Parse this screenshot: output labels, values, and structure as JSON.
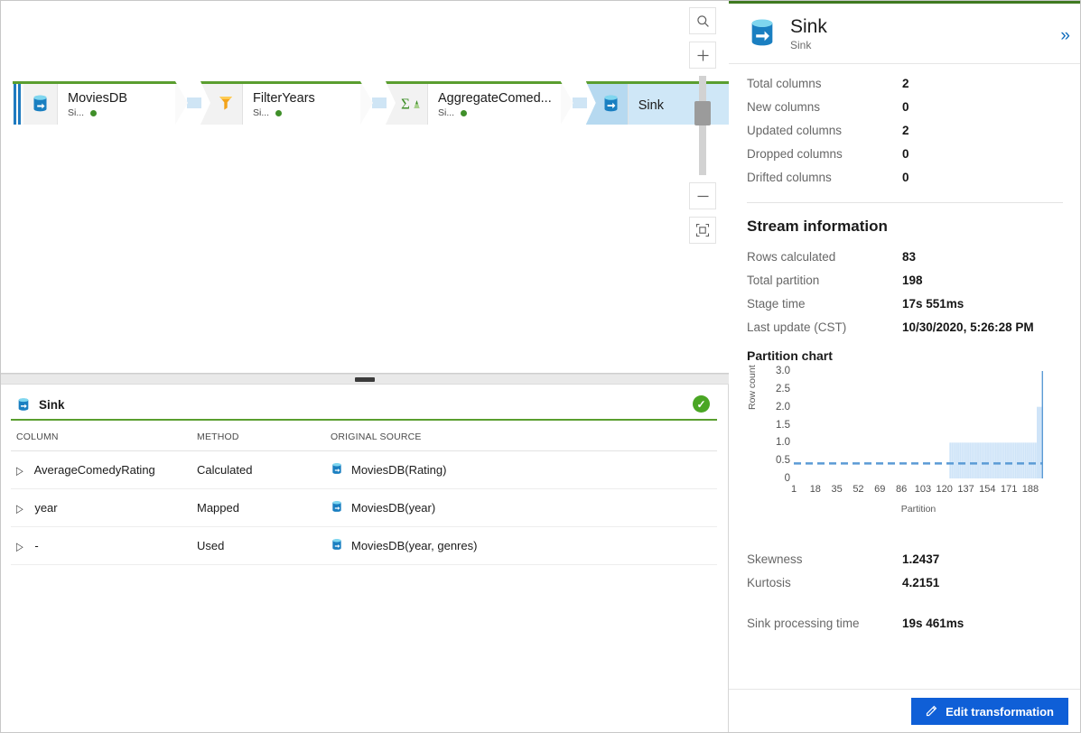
{
  "graph": {
    "nodes": [
      {
        "title": "MoviesDB",
        "subtitle": "Si...",
        "icon": "source-db-icon",
        "status": "ok",
        "selected": false
      },
      {
        "title": "FilterYears",
        "subtitle": "Si...",
        "icon": "filter-icon",
        "status": "ok",
        "selected": false
      },
      {
        "title": "AggregateComed...",
        "subtitle": "Si...",
        "icon": "aggregate-sigma-icon",
        "status": "ok",
        "selected": false
      },
      {
        "title": "Sink",
        "subtitle": "",
        "icon": "sink-db-icon",
        "status": "ok",
        "selected": true
      }
    ]
  },
  "zoom_toolbar": {
    "search_icon": "search-icon",
    "zoom_in_label": "+",
    "zoom_out_label": "–",
    "fit_icon": "fit-to-screen-icon"
  },
  "inspect_table": {
    "title": "Sink",
    "status_icon": "success-check-icon",
    "headers": [
      "COLUMN",
      "METHOD",
      "ORIGINAL SOURCE"
    ],
    "rows": [
      {
        "column": "AverageComedyRating",
        "method": "Calculated",
        "source": "MoviesDB(Rating)"
      },
      {
        "column": "year",
        "method": "Mapped",
        "source": "MoviesDB(year)"
      },
      {
        "column": "-",
        "method": "Used",
        "source": "MoviesDB(year, genres)"
      }
    ]
  },
  "panel": {
    "title": "Sink",
    "subtitle": "Sink",
    "collapse_icon": "double-chevron-right-icon",
    "column_stats": [
      {
        "label": "Total columns",
        "value": "2"
      },
      {
        "label": "New columns",
        "value": "0"
      },
      {
        "label": "Updated columns",
        "value": "2"
      },
      {
        "label": "Dropped columns",
        "value": "0"
      },
      {
        "label": "Drifted columns",
        "value": "0"
      }
    ],
    "stream_information_heading": "Stream information",
    "stream_stats": [
      {
        "label": "Rows calculated",
        "value": "83"
      },
      {
        "label": "Total partition",
        "value": "198"
      },
      {
        "label": "Stage time",
        "value": "17s 551ms"
      },
      {
        "label": "Last update (CST)",
        "value": "10/30/2020, 5:26:28 PM"
      }
    ],
    "partition_chart_heading": "Partition chart",
    "distribution_stats": [
      {
        "label": "Skewness",
        "value": "1.2437"
      },
      {
        "label": "Kurtosis",
        "value": "4.2151"
      }
    ],
    "processing_stats": [
      {
        "label": "Sink processing time",
        "value": "19s 461ms"
      }
    ],
    "edit_button_label": "Edit transformation",
    "edit_button_icon": "pencil-icon"
  },
  "colors": {
    "accent_blue": "#0f5fd7",
    "status_green": "#4aa624",
    "node_topbar_green": "#5a9e2f",
    "chart_bar": "#cfe4f8",
    "chart_mean_line": "#5b9bd5",
    "selection_blue": "#cfe7f7"
  },
  "chart_data": {
    "type": "bar",
    "title": "Partition chart",
    "xlabel": "Partition",
    "ylabel": "Row count",
    "ylim": [
      0,
      3.0
    ],
    "yticks": [
      0,
      0.5,
      1.0,
      1.5,
      2.0,
      2.5,
      3.0
    ],
    "ytick_labels": [
      "0",
      "0.5",
      "1.0",
      "1.5",
      "2.0",
      "2.5",
      "3.0"
    ],
    "xticks": [
      1,
      18,
      35,
      52,
      69,
      86,
      103,
      120,
      137,
      154,
      171,
      188
    ],
    "xlim": [
      1,
      198
    ],
    "grid": false,
    "legend": "none",
    "mean_line": 0.419,
    "bars": [
      {
        "x_start": 1,
        "x_end": 124,
        "value": 0
      },
      {
        "x_start": 124,
        "x_end": 193,
        "value": 1.0
      },
      {
        "x_start": 193,
        "x_end": 197,
        "value": 2.0
      },
      {
        "x_start": 197,
        "x_end": 198,
        "value": 3.0
      }
    ]
  }
}
